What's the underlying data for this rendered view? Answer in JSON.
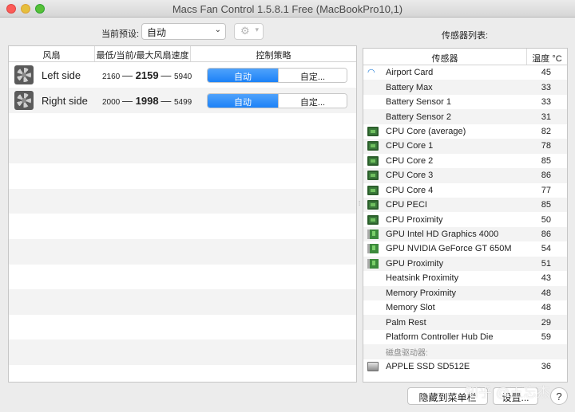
{
  "window": {
    "title": "Macs Fan Control 1.5.8.1 Free (MacBookPro10,1)"
  },
  "preset": {
    "label": "当前预设:",
    "value": "自动"
  },
  "sensor_list_title": "传感器列表:",
  "fan_table": {
    "headers": {
      "fan": "风扇",
      "speed": "最低/当前/最大风扇速度",
      "policy": "控制策略"
    },
    "rows": [
      {
        "name": "Left side",
        "min": "2160",
        "current": "2159",
        "max": "5940",
        "auto_label": "自动",
        "custom_label": "自定...",
        "mode": "auto"
      },
      {
        "name": "Right side",
        "min": "2000",
        "current": "1998",
        "max": "5499",
        "auto_label": "自动",
        "custom_label": "自定...",
        "mode": "auto"
      }
    ]
  },
  "sensor_table": {
    "headers": {
      "sensor": "传感器",
      "temp": "温度 °C"
    },
    "rows": [
      {
        "icon": "wifi-icon",
        "name": "Airport Card",
        "value": "45"
      },
      {
        "icon": "",
        "name": "Battery Max",
        "value": "33"
      },
      {
        "icon": "",
        "name": "Battery Sensor 1",
        "value": "33"
      },
      {
        "icon": "",
        "name": "Battery Sensor 2",
        "value": "31"
      },
      {
        "icon": "cpu-icon",
        "name": "CPU Core (average)",
        "value": "82"
      },
      {
        "icon": "cpu-icon",
        "name": "CPU Core 1",
        "value": "78"
      },
      {
        "icon": "cpu-icon",
        "name": "CPU Core 2",
        "value": "85"
      },
      {
        "icon": "cpu-icon",
        "name": "CPU Core 3",
        "value": "86"
      },
      {
        "icon": "cpu-icon",
        "name": "CPU Core 4",
        "value": "77"
      },
      {
        "icon": "cpu-icon",
        "name": "CPU PECI",
        "value": "85"
      },
      {
        "icon": "cpu-icon",
        "name": "CPU Proximity",
        "value": "50"
      },
      {
        "icon": "gpu-icon",
        "name": "GPU Intel HD Graphics 4000",
        "value": "86"
      },
      {
        "icon": "gpu-icon",
        "name": "GPU NVIDIA GeForce GT 650M",
        "value": "54"
      },
      {
        "icon": "gpu-icon",
        "name": "GPU Proximity",
        "value": "51"
      },
      {
        "icon": "",
        "name": "Heatsink Proximity",
        "value": "43"
      },
      {
        "icon": "",
        "name": "Memory Proximity",
        "value": "48"
      },
      {
        "icon": "",
        "name": "Memory Slot",
        "value": "48"
      },
      {
        "icon": "",
        "name": "Palm Rest",
        "value": "29"
      },
      {
        "icon": "",
        "name": "Platform Controller Hub Die",
        "value": "59"
      }
    ],
    "group_label": "磁盘驱动器:",
    "disk_rows": [
      {
        "icon": "ssd-icon",
        "name": "APPLE SSD SD512E",
        "value": "36"
      }
    ]
  },
  "buttons": {
    "hide_to_menubar": "隐藏到菜单栏",
    "settings": "设置...",
    "help": "?"
  },
  "watermark": "知乎 @王忘杰",
  "colors": {
    "accent": "#1c82f7",
    "close": "#fc5b57",
    "minimize": "#e5bf3c",
    "maximize": "#57c038"
  }
}
